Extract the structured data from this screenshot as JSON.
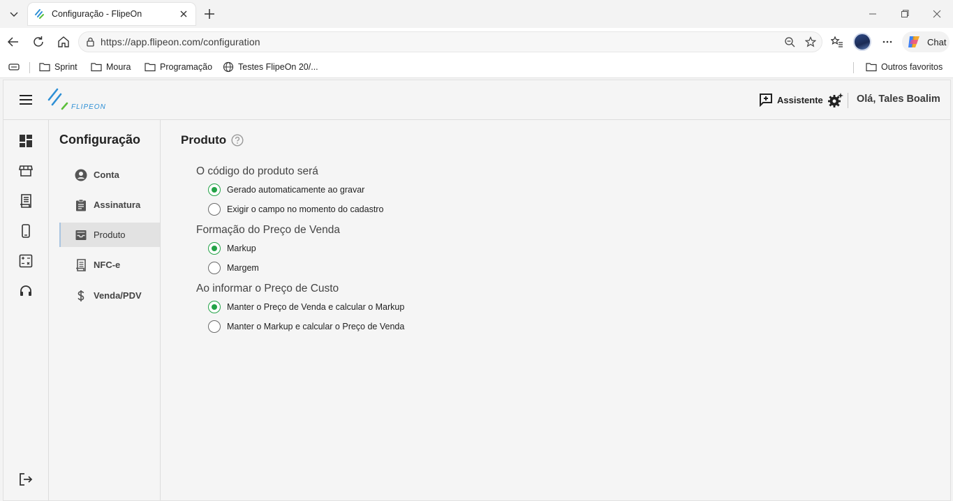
{
  "browser": {
    "tab_title": "Configuração - FlipeOn",
    "url": "https://app.flipeon.com/configuration",
    "chat_label": "Chat",
    "bookmarks": [
      "Sprint",
      "Moura",
      "Programação",
      "Testes FlipeOn 20/..."
    ],
    "other_bookmarks": "Outros favoritos"
  },
  "header": {
    "logo_text": "FLIPEON",
    "assistant_label": "Assistente",
    "greeting": "Olá, Tales Boalim"
  },
  "rail": {
    "items": [
      "dashboard-icon",
      "store-icon",
      "receipt-icon",
      "smartphone-icon",
      "calculator-icon",
      "headset-icon"
    ],
    "logout_icon": "logout-icon"
  },
  "submenu": {
    "title": "Configuração",
    "items": [
      {
        "label": "Conta",
        "icon": "account-circle-icon",
        "active": false
      },
      {
        "label": "Assinatura",
        "icon": "clipboard-icon",
        "active": false
      },
      {
        "label": "Produto",
        "icon": "inbox-icon",
        "active": true
      },
      {
        "label": "NFC-e",
        "icon": "receipt-icon",
        "active": false
      },
      {
        "label": "Venda/PDV",
        "icon": "dollar-icon",
        "active": false
      }
    ]
  },
  "content": {
    "title": "Produto",
    "groups": [
      {
        "label": "O código do produto será",
        "options": [
          {
            "label": "Gerado automaticamente ao gravar",
            "checked": true
          },
          {
            "label": "Exigir o campo no momento do cadastro",
            "checked": false
          }
        ]
      },
      {
        "label": "Formação do Preço de Venda",
        "options": [
          {
            "label": "Markup",
            "checked": true
          },
          {
            "label": "Margem",
            "checked": false
          }
        ]
      },
      {
        "label": "Ao informar o Preço de Custo",
        "options": [
          {
            "label": "Manter o Preço de Venda e calcular o Markup",
            "checked": true
          },
          {
            "label": "Manter o Markup e calcular o Preço de Venda",
            "checked": false
          }
        ]
      }
    ]
  },
  "colors": {
    "accent_green": "#23a347",
    "logo_blue": "#2d8fd5",
    "logo_green": "#5bbf3a"
  }
}
